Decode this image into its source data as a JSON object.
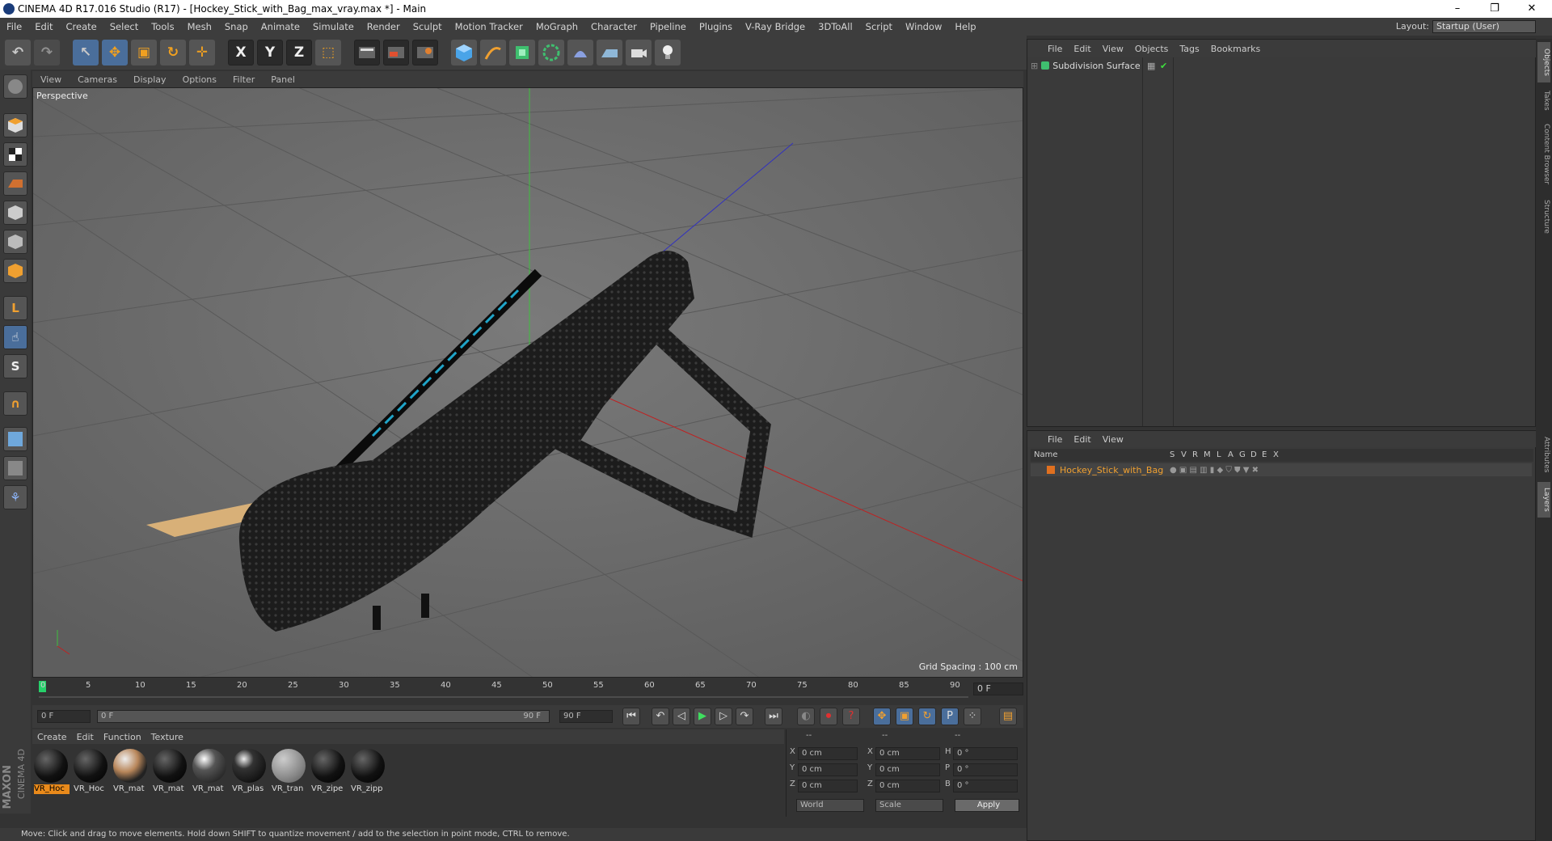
{
  "window": {
    "title": "CINEMA 4D R17.016 Studio (R17) - [Hockey_Stick_with_Bag_max_vray.max *] - Main",
    "min": "–",
    "max": "❐",
    "close": "✕"
  },
  "menubar": [
    "File",
    "Edit",
    "Create",
    "Select",
    "Tools",
    "Mesh",
    "Snap",
    "Animate",
    "Simulate",
    "Render",
    "Sculpt",
    "Motion Tracker",
    "MoGraph",
    "Character",
    "Pipeline",
    "Plugins",
    "V-Ray Bridge",
    "3DToAll",
    "Script",
    "Window",
    "Help"
  ],
  "layout": {
    "label": "Layout:",
    "value": "Startup (User)"
  },
  "toolbar": {
    "undo": "↶",
    "redo": "↷",
    "select": "↖",
    "move": "✥",
    "scale": "▣",
    "rotate": "↻",
    "add": "✛",
    "x": "X",
    "y": "Y",
    "z": "Z",
    "coord": "⬚"
  },
  "viewport": {
    "menu": [
      "View",
      "Cameras",
      "Display",
      "Options",
      "Filter",
      "Panel"
    ],
    "label": "Perspective",
    "grid": "Grid Spacing : 100 cm"
  },
  "timeline": {
    "ticks": [
      "0",
      "5",
      "10",
      "15",
      "20",
      "25",
      "30",
      "35",
      "40",
      "45",
      "50",
      "55",
      "60",
      "65",
      "70",
      "75",
      "80",
      "85",
      "90"
    ],
    "frame_right": "0 F",
    "start": "0 F",
    "range_start": "0 F",
    "range_end": "90 F",
    "end": "90 F"
  },
  "materials": {
    "menu": [
      "Create",
      "Edit",
      "Function",
      "Texture"
    ],
    "items": [
      "VR_Hoc",
      "VR_Hoc",
      "VR_mat",
      "VR_mat",
      "VR_mat",
      "VR_plas",
      "VR_tran",
      "VR_zipe",
      "VR_zipp"
    ]
  },
  "coords": {
    "header": [
      "--",
      "--",
      "--"
    ],
    "rows": [
      [
        "X",
        "0 cm",
        "X",
        "0 cm",
        "H",
        "0 °"
      ],
      [
        "Y",
        "0 cm",
        "Y",
        "0 cm",
        "P",
        "0 °"
      ],
      [
        "Z",
        "0 cm",
        "Z",
        "0 cm",
        "B",
        "0 °"
      ]
    ],
    "world": "World",
    "scale": "Scale",
    "apply": "Apply"
  },
  "objects": {
    "menu": [
      "File",
      "Edit",
      "View",
      "Objects",
      "Tags",
      "Bookmarks"
    ],
    "item": "Subdivision Surface"
  },
  "layers": {
    "menu": [
      "File",
      "Edit",
      "View"
    ],
    "headers": [
      "Name",
      "S",
      "V",
      "R",
      "M",
      "L",
      "A",
      "G",
      "D",
      "E",
      "X"
    ],
    "item": "Hockey_Stick_with_Bag",
    "item_color": "#e07020"
  },
  "sidetabs": [
    "Objects",
    "Takes",
    "Content Browser",
    "Structure",
    "Attributes",
    "Layers"
  ],
  "status": "Move: Click and drag to move elements. Hold down SHIFT to quantize movement / add to the selection in point mode, CTRL to remove.",
  "brand": [
    "MAXON",
    "CINEMA 4D"
  ]
}
